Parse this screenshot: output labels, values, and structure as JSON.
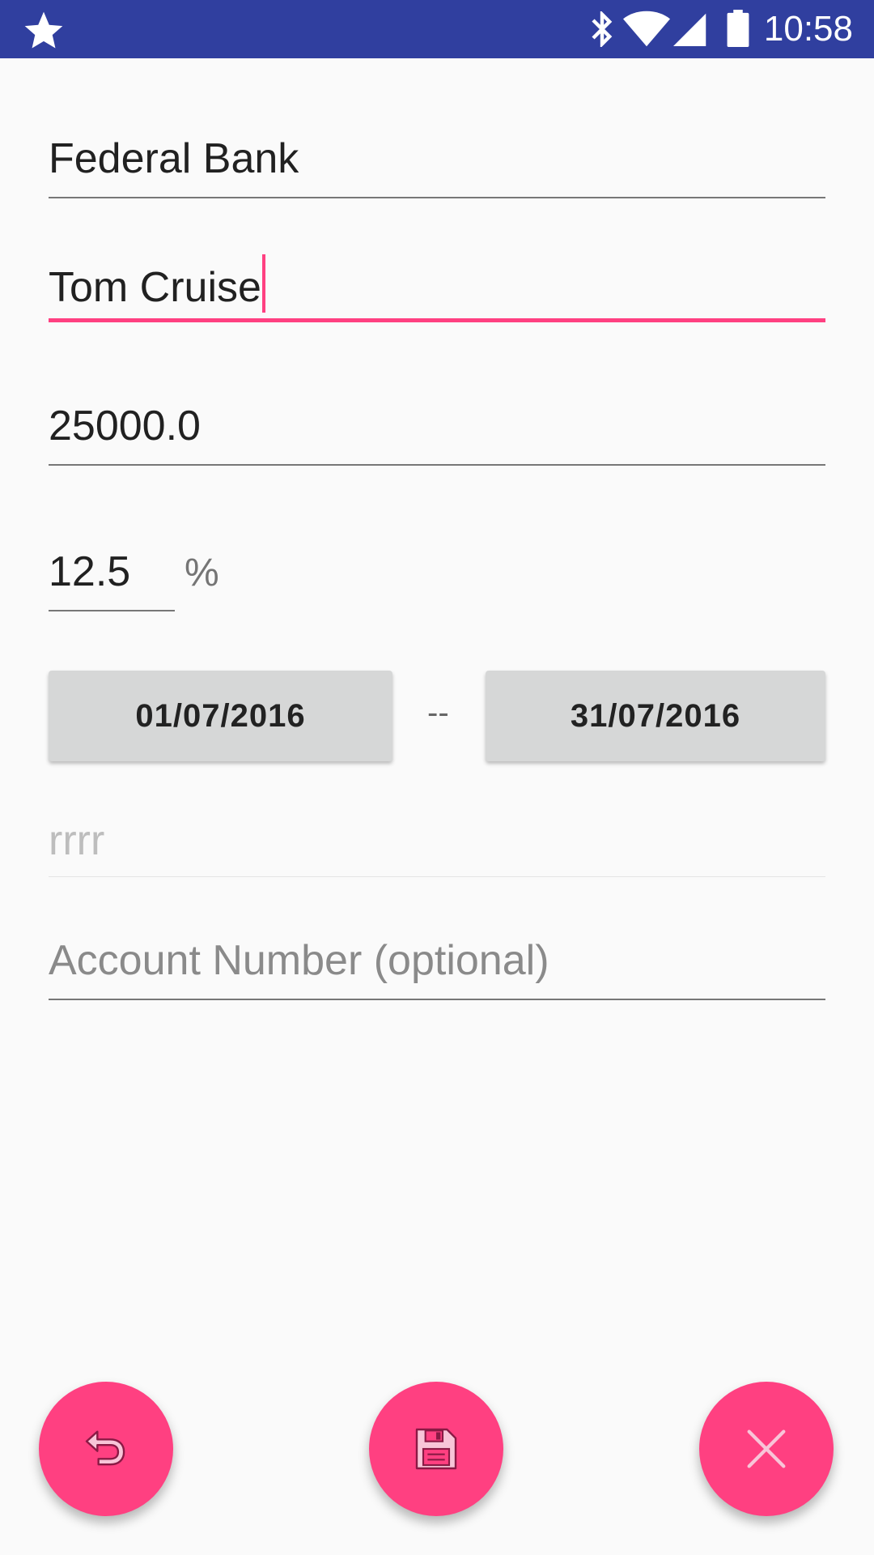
{
  "status_bar": {
    "time": "10:58"
  },
  "form": {
    "bank_name": "Federal Bank",
    "holder_name": "Tom Cruise",
    "amount": "25000.0",
    "rate": "12.5",
    "rate_unit": "%",
    "start_date": "01/07/2016",
    "date_separator": "--",
    "end_date": "31/07/2016",
    "note_value": "rrrr",
    "account_placeholder": "Account Number (optional)"
  },
  "colors": {
    "status_bar": "#303f9f",
    "accent": "#ff4081",
    "background": "#fafafa"
  },
  "fabs": {
    "undo_icon": "undo-icon",
    "save_icon": "floppy-disk-icon",
    "close_icon": "close-icon"
  }
}
